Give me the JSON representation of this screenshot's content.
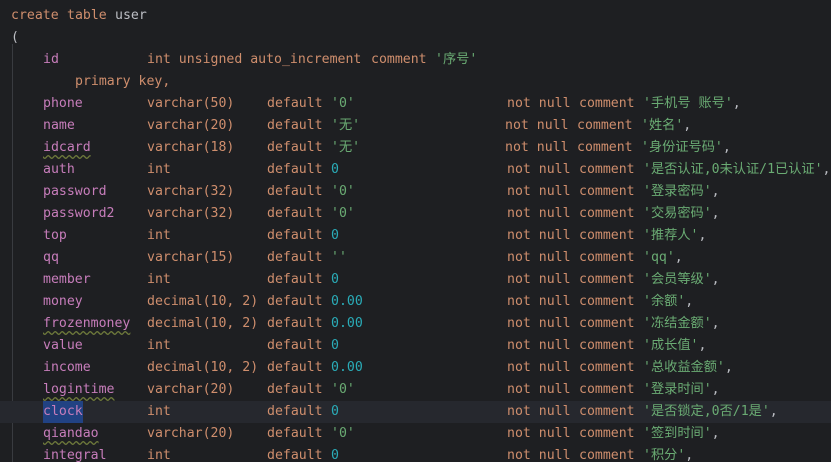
{
  "editor": {
    "line_create": {
      "kw1": "create",
      "kw2": "table",
      "ident": "user"
    },
    "open_paren": "(",
    "id_row": {
      "name": "id",
      "type": "int unsigned auto_increment",
      "kw_comment": "comment",
      "comment": "'序号'",
      "continuation": "primary key,"
    },
    "kw_default": "default",
    "kw_not_null": "not null",
    "kw_comment": "comment",
    "columns": [
      {
        "name": "phone",
        "type": "varchar(50)",
        "def": "'0'",
        "comment": "'手机号 账号'",
        "end": ","
      },
      {
        "name": "name",
        "type": "varchar(20)",
        "def": "'无'",
        "comment": "'姓名'",
        "end": ","
      },
      {
        "name": "idcard",
        "type": "varchar(18)",
        "def": "'无'",
        "comment": "'身份证号码'",
        "end": ","
      },
      {
        "name": "auth",
        "type": "int",
        "def": "0",
        "comment": "'是否认证,0未认证/1已认证'",
        "end": ","
      },
      {
        "name": "password",
        "type": "varchar(32)",
        "def": "'0'",
        "comment": "'登录密码'",
        "end": ","
      },
      {
        "name": "password2",
        "type": "varchar(32)",
        "def": "'0'",
        "comment": "'交易密码'",
        "end": ","
      },
      {
        "name": "top",
        "type": "int",
        "def": "0",
        "comment": "'推荐人'",
        "end": ","
      },
      {
        "name": "qq",
        "type": "varchar(15)",
        "def": "''",
        "comment": "'qq'",
        "end": ","
      },
      {
        "name": "member",
        "type": "int",
        "def": "0",
        "comment": "'会员等级'",
        "end": ","
      },
      {
        "name": "money",
        "type": "decimal(10, 2)",
        "def": "0.00",
        "comment": "'余额'",
        "end": ","
      },
      {
        "name": "frozenmoney",
        "type": "decimal(10, 2)",
        "def": "0.00",
        "comment": "'冻结金额'",
        "end": ","
      },
      {
        "name": "value",
        "type": "int",
        "def": "0",
        "comment": "'成长值'",
        "end": ","
      },
      {
        "name": "income",
        "type": "decimal(10, 2)",
        "def": "0.00",
        "comment": "'总收益金额'",
        "end": ","
      },
      {
        "name": "logintime",
        "type": "varchar(20)",
        "def": "'0'",
        "comment": "'登录时间'",
        "end": ","
      },
      {
        "name": "clock",
        "type": "int",
        "def": "0",
        "comment": "'是否锁定,0否/1是'",
        "end": ","
      },
      {
        "name": "qiandao",
        "type": "varchar(20)",
        "def": "'0'",
        "comment": "'签到时间'",
        "end": ","
      },
      {
        "name": "integral",
        "type": "int",
        "def": "0",
        "comment": "'积分'",
        "end": ","
      }
    ]
  },
  "colors": {
    "background": "#1e1f22",
    "keyword": "#cf8e6d",
    "column": "#c77dbb",
    "string": "#6aab73",
    "number": "#2aacb8",
    "text": "#bcbec4",
    "selection": "#214283"
  }
}
